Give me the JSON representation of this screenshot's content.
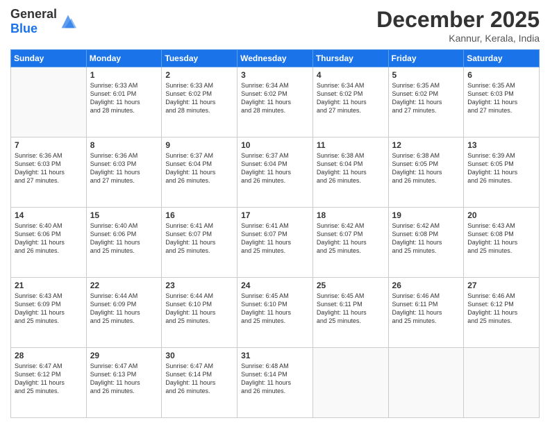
{
  "logo": {
    "text_general": "General",
    "text_blue": "Blue"
  },
  "header": {
    "month_year": "December 2025",
    "location": "Kannur, Kerala, India"
  },
  "weekdays": [
    "Sunday",
    "Monday",
    "Tuesday",
    "Wednesday",
    "Thursday",
    "Friday",
    "Saturday"
  ],
  "weeks": [
    [
      {
        "day": "",
        "info": ""
      },
      {
        "day": "1",
        "info": "Sunrise: 6:33 AM\nSunset: 6:01 PM\nDaylight: 11 hours\nand 28 minutes."
      },
      {
        "day": "2",
        "info": "Sunrise: 6:33 AM\nSunset: 6:02 PM\nDaylight: 11 hours\nand 28 minutes."
      },
      {
        "day": "3",
        "info": "Sunrise: 6:34 AM\nSunset: 6:02 PM\nDaylight: 11 hours\nand 28 minutes."
      },
      {
        "day": "4",
        "info": "Sunrise: 6:34 AM\nSunset: 6:02 PM\nDaylight: 11 hours\nand 27 minutes."
      },
      {
        "day": "5",
        "info": "Sunrise: 6:35 AM\nSunset: 6:02 PM\nDaylight: 11 hours\nand 27 minutes."
      },
      {
        "day": "6",
        "info": "Sunrise: 6:35 AM\nSunset: 6:03 PM\nDaylight: 11 hours\nand 27 minutes."
      }
    ],
    [
      {
        "day": "7",
        "info": "Sunrise: 6:36 AM\nSunset: 6:03 PM\nDaylight: 11 hours\nand 27 minutes."
      },
      {
        "day": "8",
        "info": "Sunrise: 6:36 AM\nSunset: 6:03 PM\nDaylight: 11 hours\nand 27 minutes."
      },
      {
        "day": "9",
        "info": "Sunrise: 6:37 AM\nSunset: 6:04 PM\nDaylight: 11 hours\nand 26 minutes."
      },
      {
        "day": "10",
        "info": "Sunrise: 6:37 AM\nSunset: 6:04 PM\nDaylight: 11 hours\nand 26 minutes."
      },
      {
        "day": "11",
        "info": "Sunrise: 6:38 AM\nSunset: 6:04 PM\nDaylight: 11 hours\nand 26 minutes."
      },
      {
        "day": "12",
        "info": "Sunrise: 6:38 AM\nSunset: 6:05 PM\nDaylight: 11 hours\nand 26 minutes."
      },
      {
        "day": "13",
        "info": "Sunrise: 6:39 AM\nSunset: 6:05 PM\nDaylight: 11 hours\nand 26 minutes."
      }
    ],
    [
      {
        "day": "14",
        "info": "Sunrise: 6:40 AM\nSunset: 6:06 PM\nDaylight: 11 hours\nand 26 minutes."
      },
      {
        "day": "15",
        "info": "Sunrise: 6:40 AM\nSunset: 6:06 PM\nDaylight: 11 hours\nand 25 minutes."
      },
      {
        "day": "16",
        "info": "Sunrise: 6:41 AM\nSunset: 6:07 PM\nDaylight: 11 hours\nand 25 minutes."
      },
      {
        "day": "17",
        "info": "Sunrise: 6:41 AM\nSunset: 6:07 PM\nDaylight: 11 hours\nand 25 minutes."
      },
      {
        "day": "18",
        "info": "Sunrise: 6:42 AM\nSunset: 6:07 PM\nDaylight: 11 hours\nand 25 minutes."
      },
      {
        "day": "19",
        "info": "Sunrise: 6:42 AM\nSunset: 6:08 PM\nDaylight: 11 hours\nand 25 minutes."
      },
      {
        "day": "20",
        "info": "Sunrise: 6:43 AM\nSunset: 6:08 PM\nDaylight: 11 hours\nand 25 minutes."
      }
    ],
    [
      {
        "day": "21",
        "info": "Sunrise: 6:43 AM\nSunset: 6:09 PM\nDaylight: 11 hours\nand 25 minutes."
      },
      {
        "day": "22",
        "info": "Sunrise: 6:44 AM\nSunset: 6:09 PM\nDaylight: 11 hours\nand 25 minutes."
      },
      {
        "day": "23",
        "info": "Sunrise: 6:44 AM\nSunset: 6:10 PM\nDaylight: 11 hours\nand 25 minutes."
      },
      {
        "day": "24",
        "info": "Sunrise: 6:45 AM\nSunset: 6:10 PM\nDaylight: 11 hours\nand 25 minutes."
      },
      {
        "day": "25",
        "info": "Sunrise: 6:45 AM\nSunset: 6:11 PM\nDaylight: 11 hours\nand 25 minutes."
      },
      {
        "day": "26",
        "info": "Sunrise: 6:46 AM\nSunset: 6:11 PM\nDaylight: 11 hours\nand 25 minutes."
      },
      {
        "day": "27",
        "info": "Sunrise: 6:46 AM\nSunset: 6:12 PM\nDaylight: 11 hours\nand 25 minutes."
      }
    ],
    [
      {
        "day": "28",
        "info": "Sunrise: 6:47 AM\nSunset: 6:12 PM\nDaylight: 11 hours\nand 25 minutes."
      },
      {
        "day": "29",
        "info": "Sunrise: 6:47 AM\nSunset: 6:13 PM\nDaylight: 11 hours\nand 26 minutes."
      },
      {
        "day": "30",
        "info": "Sunrise: 6:47 AM\nSunset: 6:14 PM\nDaylight: 11 hours\nand 26 minutes."
      },
      {
        "day": "31",
        "info": "Sunrise: 6:48 AM\nSunset: 6:14 PM\nDaylight: 11 hours\nand 26 minutes."
      },
      {
        "day": "",
        "info": ""
      },
      {
        "day": "",
        "info": ""
      },
      {
        "day": "",
        "info": ""
      }
    ]
  ]
}
